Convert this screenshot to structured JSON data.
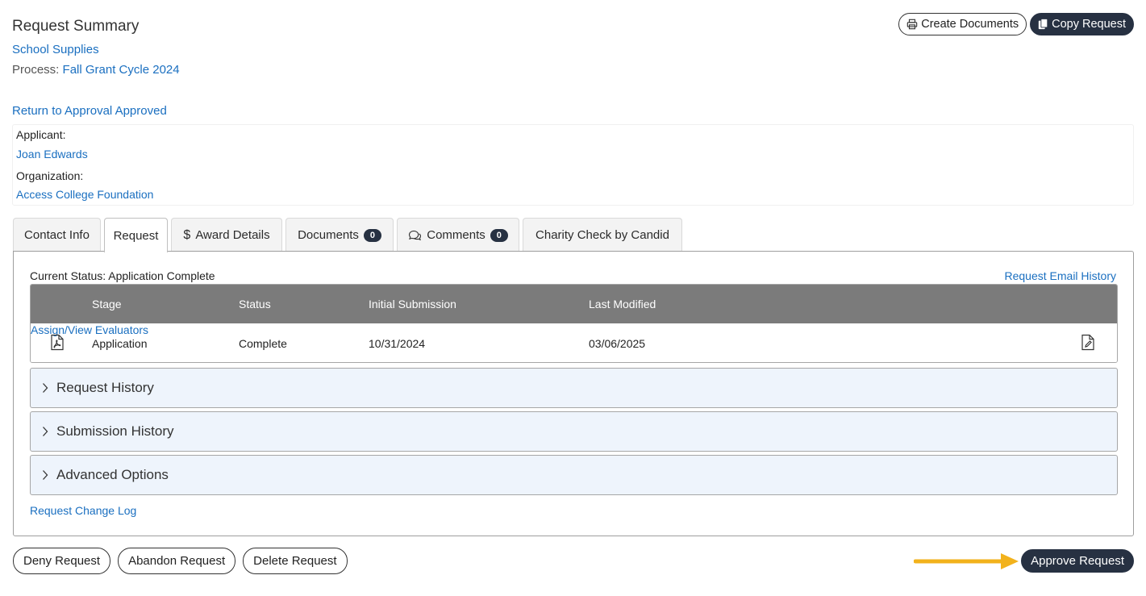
{
  "header": {
    "title": "Request Summary",
    "request_name": "School Supplies",
    "process_label": "Process:",
    "process_value": "Fall Grant Cycle 2024",
    "return_link": "Return to Approval Approved"
  },
  "top_actions": {
    "create_documents": "Create Documents",
    "copy_request": "Copy Request"
  },
  "applicant": {
    "applicant_label": "Applicant:",
    "applicant_name": "Joan Edwards",
    "organization_label": "Organization:",
    "organization_name": "Access College Foundation"
  },
  "tabs": [
    {
      "label": "Contact Info"
    },
    {
      "label": "Request",
      "active": true
    },
    {
      "label": "Award Details",
      "icon": "dollar-icon"
    },
    {
      "label": "Documents",
      "badge": "0"
    },
    {
      "label": "Comments",
      "badge": "0",
      "icon": "comments-icon"
    },
    {
      "label": "Charity Check by Candid"
    }
  ],
  "panel": {
    "current_status": "Current Status: Application Complete",
    "email_history": "Request Email History",
    "table": {
      "headers": [
        "Stage",
        "Status",
        "Initial Submission",
        "Last Modified"
      ],
      "row": {
        "stage": "Application",
        "status": "Complete",
        "initial_submission": "10/31/2024",
        "last_modified": "03/06/2025",
        "evaluators_link": "Assign/View Evaluators"
      }
    },
    "accordions": [
      {
        "label": "Request History"
      },
      {
        "label": "Submission History"
      },
      {
        "label": "Advanced Options"
      }
    ],
    "change_log": "Request Change Log"
  },
  "bottom_actions": {
    "deny": "Deny Request",
    "abandon": "Abandon Request",
    "delete": "Delete Request",
    "approve": "Approve Request"
  },
  "colors": {
    "link": "#1a6fc0",
    "dark_button": "#273142",
    "table_header": "#7b7b7b",
    "accordion_bg": "#eef4fc",
    "arrow": "#f2b21c"
  }
}
